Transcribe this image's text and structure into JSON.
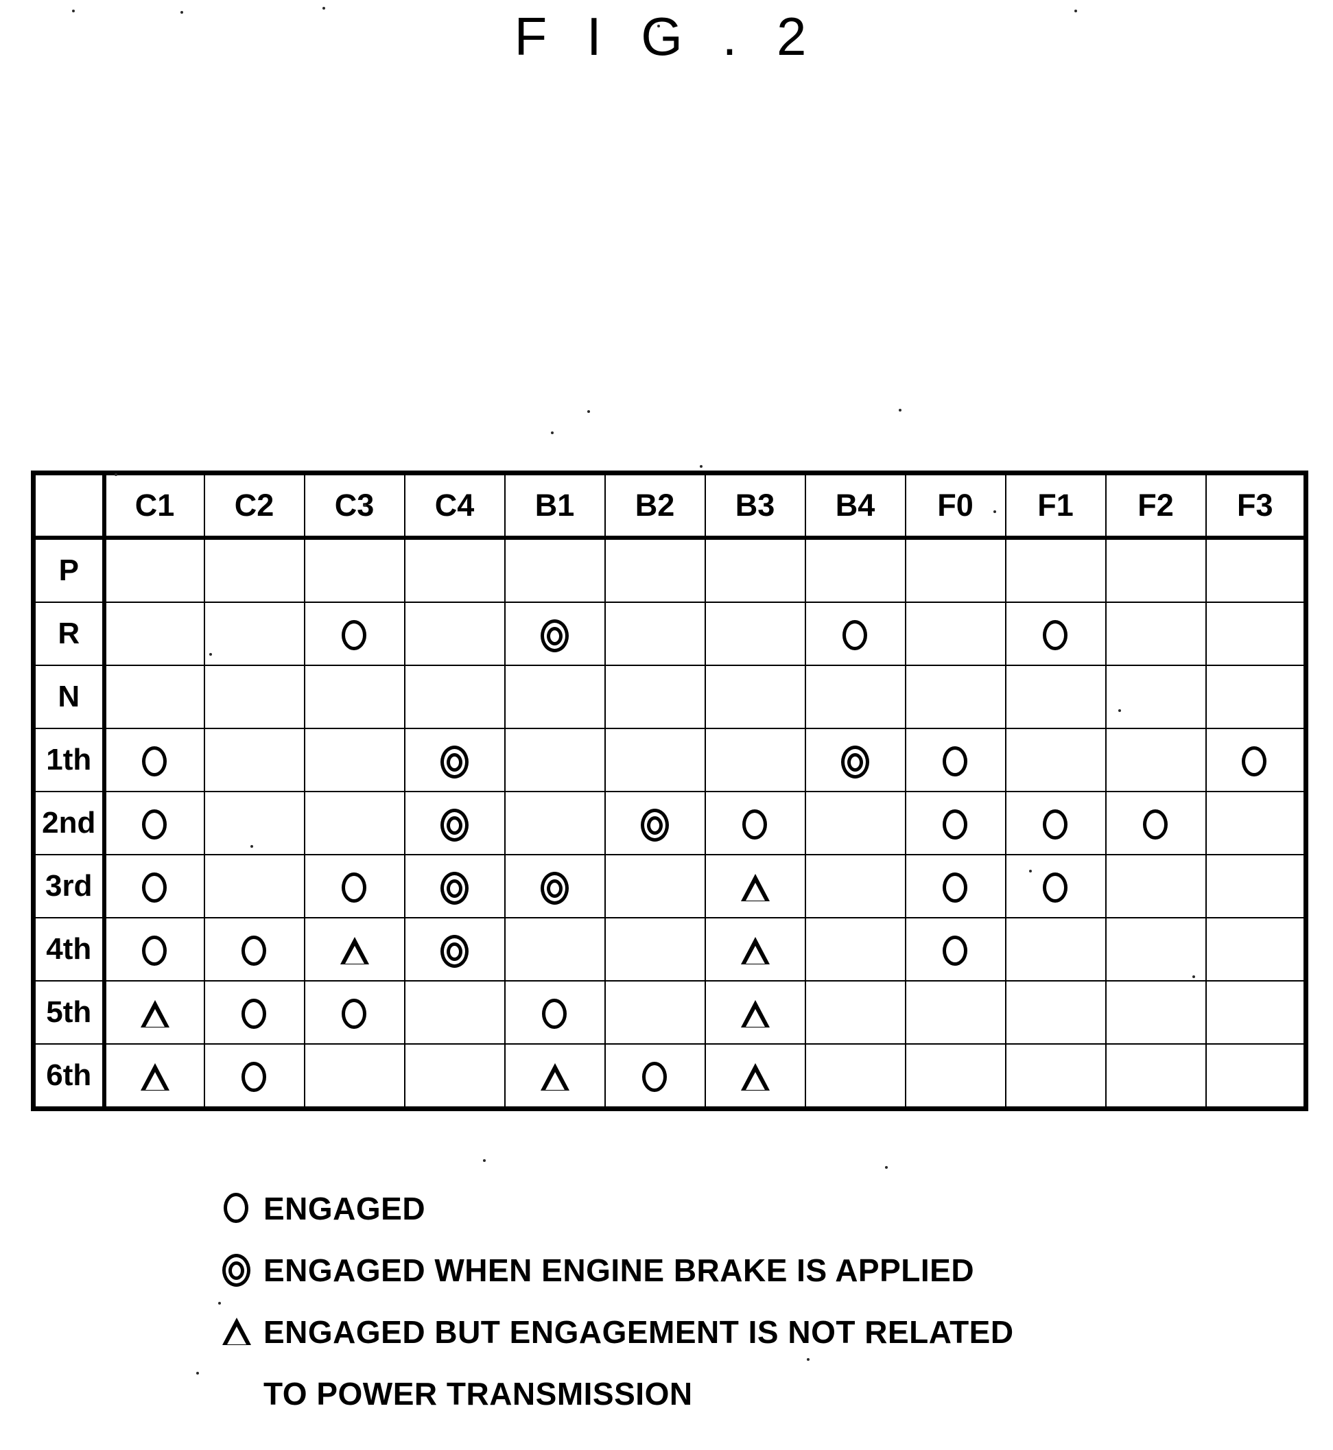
{
  "figure": {
    "title": "F I G . 2"
  },
  "chart_data": {
    "type": "table",
    "title": "F I G . 2",
    "description": "Automatic transmission engagement table: gear/range vs. clutch, brake and one-way-clutch element engagement states.",
    "row_header_label": "",
    "columns": [
      "C1",
      "C2",
      "C3",
      "C4",
      "B1",
      "B2",
      "B3",
      "B4",
      "F0",
      "F1",
      "F2",
      "F3"
    ],
    "row_labels": [
      "P",
      "R",
      "N",
      "1th",
      "2nd",
      "3rd",
      "4th",
      "5th",
      "6th"
    ],
    "symbols": {
      "circle": "O",
      "dblcircle": "◎",
      "triangle": "△",
      "empty": ""
    },
    "rows": [
      {
        "label": "P",
        "cells": [
          "empty",
          "empty",
          "empty",
          "empty",
          "empty",
          "empty",
          "empty",
          "empty",
          "empty",
          "empty",
          "empty",
          "empty"
        ]
      },
      {
        "label": "R",
        "cells": [
          "empty",
          "empty",
          "circle",
          "empty",
          "dblcircle",
          "empty",
          "empty",
          "circle",
          "empty",
          "circle",
          "empty",
          "empty"
        ]
      },
      {
        "label": "N",
        "cells": [
          "empty",
          "empty",
          "empty",
          "empty",
          "empty",
          "empty",
          "empty",
          "empty",
          "empty",
          "empty",
          "empty",
          "empty"
        ]
      },
      {
        "label": "1th",
        "cells": [
          "circle",
          "empty",
          "empty",
          "dblcircle",
          "empty",
          "empty",
          "empty",
          "dblcircle",
          "circle",
          "empty",
          "empty",
          "circle"
        ]
      },
      {
        "label": "2nd",
        "cells": [
          "circle",
          "empty",
          "empty",
          "dblcircle",
          "empty",
          "dblcircle",
          "circle",
          "empty",
          "circle",
          "circle",
          "circle",
          "empty"
        ]
      },
      {
        "label": "3rd",
        "cells": [
          "circle",
          "empty",
          "circle",
          "dblcircle",
          "dblcircle",
          "empty",
          "triangle",
          "empty",
          "circle",
          "circle",
          "empty",
          "empty"
        ]
      },
      {
        "label": "4th",
        "cells": [
          "circle",
          "circle",
          "triangle",
          "dblcircle",
          "empty",
          "empty",
          "triangle",
          "empty",
          "circle",
          "empty",
          "empty",
          "empty"
        ]
      },
      {
        "label": "5th",
        "cells": [
          "triangle",
          "circle",
          "circle",
          "empty",
          "circle",
          "empty",
          "triangle",
          "empty",
          "empty",
          "empty",
          "empty",
          "empty"
        ]
      },
      {
        "label": "6th",
        "cells": [
          "triangle",
          "circle",
          "empty",
          "empty",
          "triangle",
          "circle",
          "triangle",
          "empty",
          "empty",
          "empty",
          "empty",
          "empty"
        ]
      }
    ]
  },
  "legend": {
    "items": [
      {
        "symbol": "circle",
        "text": "ENGAGED",
        "continuation": ""
      },
      {
        "symbol": "dblcircle",
        "text": "ENGAGED WHEN ENGINE BRAKE IS APPLIED",
        "continuation": ""
      },
      {
        "symbol": "triangle",
        "text": "ENGAGED BUT ENGAGEMENT IS NOT RELATED",
        "continuation": "TO POWER TRANSMISSION"
      }
    ]
  }
}
